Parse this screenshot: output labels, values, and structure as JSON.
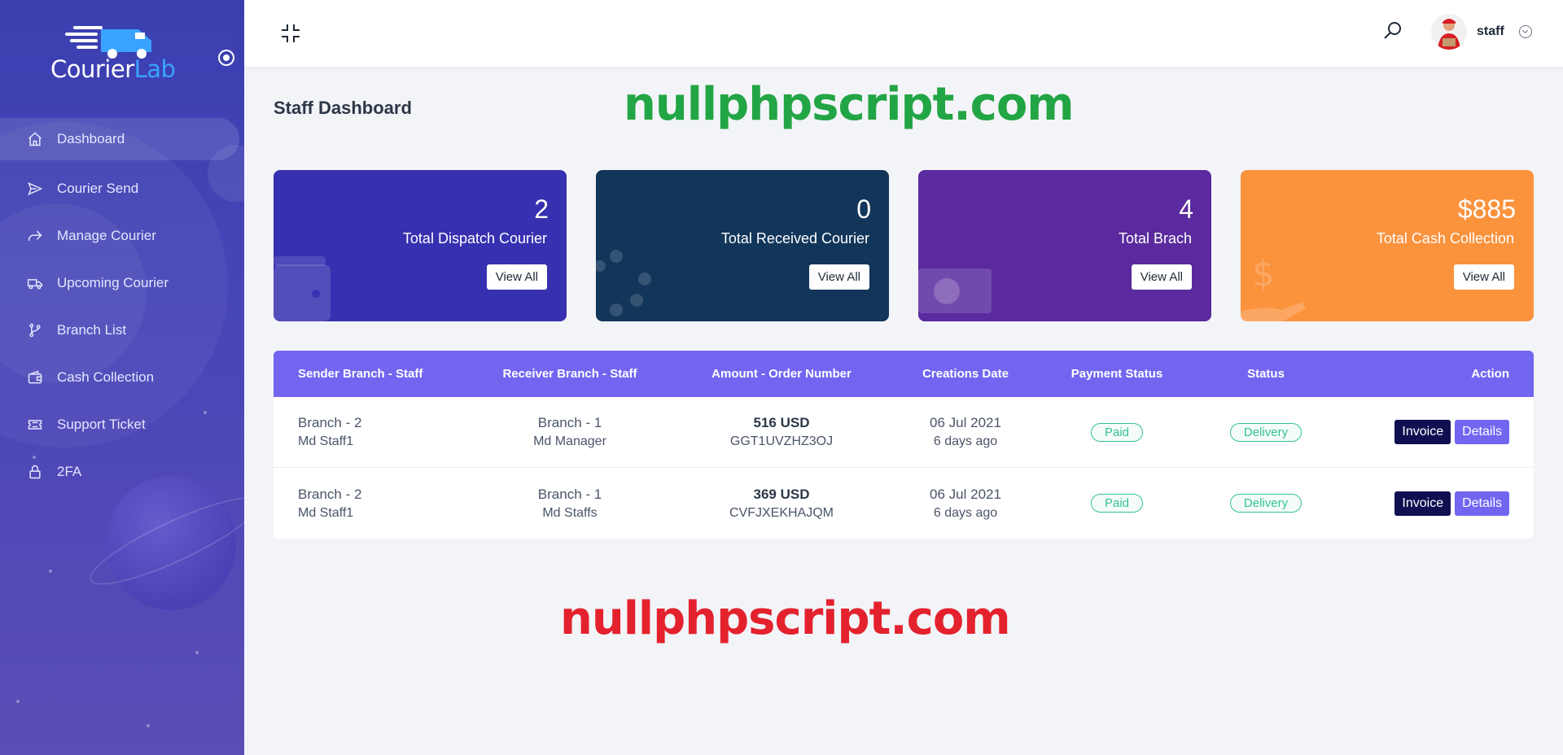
{
  "brand": {
    "name_part1": "Courier",
    "name_part2": "Lab"
  },
  "sidebar": {
    "items": [
      {
        "label": "Dashboard",
        "icon": "home-icon"
      },
      {
        "label": "Courier Send",
        "icon": "send-icon"
      },
      {
        "label": "Manage Courier",
        "icon": "share-arrow-icon"
      },
      {
        "label": "Upcoming Courier",
        "icon": "truck-icon"
      },
      {
        "label": "Branch List",
        "icon": "branch-icon"
      },
      {
        "label": "Cash Collection",
        "icon": "wallet-icon"
      },
      {
        "label": "Support Ticket",
        "icon": "ticket-icon"
      },
      {
        "label": "2FA",
        "icon": "lock-icon"
      }
    ]
  },
  "header": {
    "user_name": "staff"
  },
  "page": {
    "title": "Staff Dashboard",
    "watermark_top": "nullphpscript.com",
    "watermark_bottom": "nullphpscript.com"
  },
  "cards": [
    {
      "value": "2",
      "label": "Total Dispatch Courier",
      "button": "View All",
      "color": "#3730b0"
    },
    {
      "value": "0",
      "label": "Total Received Courier",
      "button": "View All",
      "color": "#12365a"
    },
    {
      "value": "4",
      "label": "Total Brach",
      "button": "View All",
      "color": "#5a2a9e"
    },
    {
      "value": "$885",
      "label": "Total Cash Collection",
      "button": "View All",
      "color": "#fb923c"
    }
  ],
  "table": {
    "headers": [
      "Sender Branch - Staff",
      "Receiver Branch - Staff",
      "Amount - Order Number",
      "Creations Date",
      "Payment Status",
      "Status",
      "Action"
    ],
    "rows": [
      {
        "sender_branch": "Branch - 2",
        "sender_staff": "Md Staff1",
        "receiver_branch": "Branch - 1",
        "receiver_staff": "Md Manager",
        "amount": "516 USD",
        "order": "GGT1UVZHZ3OJ",
        "date": "06 Jul 2021",
        "ago": "6 days ago",
        "payment": "Paid",
        "status": "Delivery",
        "invoice": "Invoice",
        "details": "Details"
      },
      {
        "sender_branch": "Branch - 2",
        "sender_staff": "Md Staff1",
        "receiver_branch": "Branch - 1",
        "receiver_staff": "Md Staffs",
        "amount": "369 USD",
        "order": "CVFJXEKHAJQM",
        "date": "06 Jul 2021",
        "ago": "6 days ago",
        "payment": "Paid",
        "status": "Delivery",
        "invoice": "Invoice",
        "details": "Details"
      }
    ]
  },
  "colors": {
    "accent": "#7266f0",
    "invoice": "#0f0f52",
    "badge": "#34c38f"
  }
}
